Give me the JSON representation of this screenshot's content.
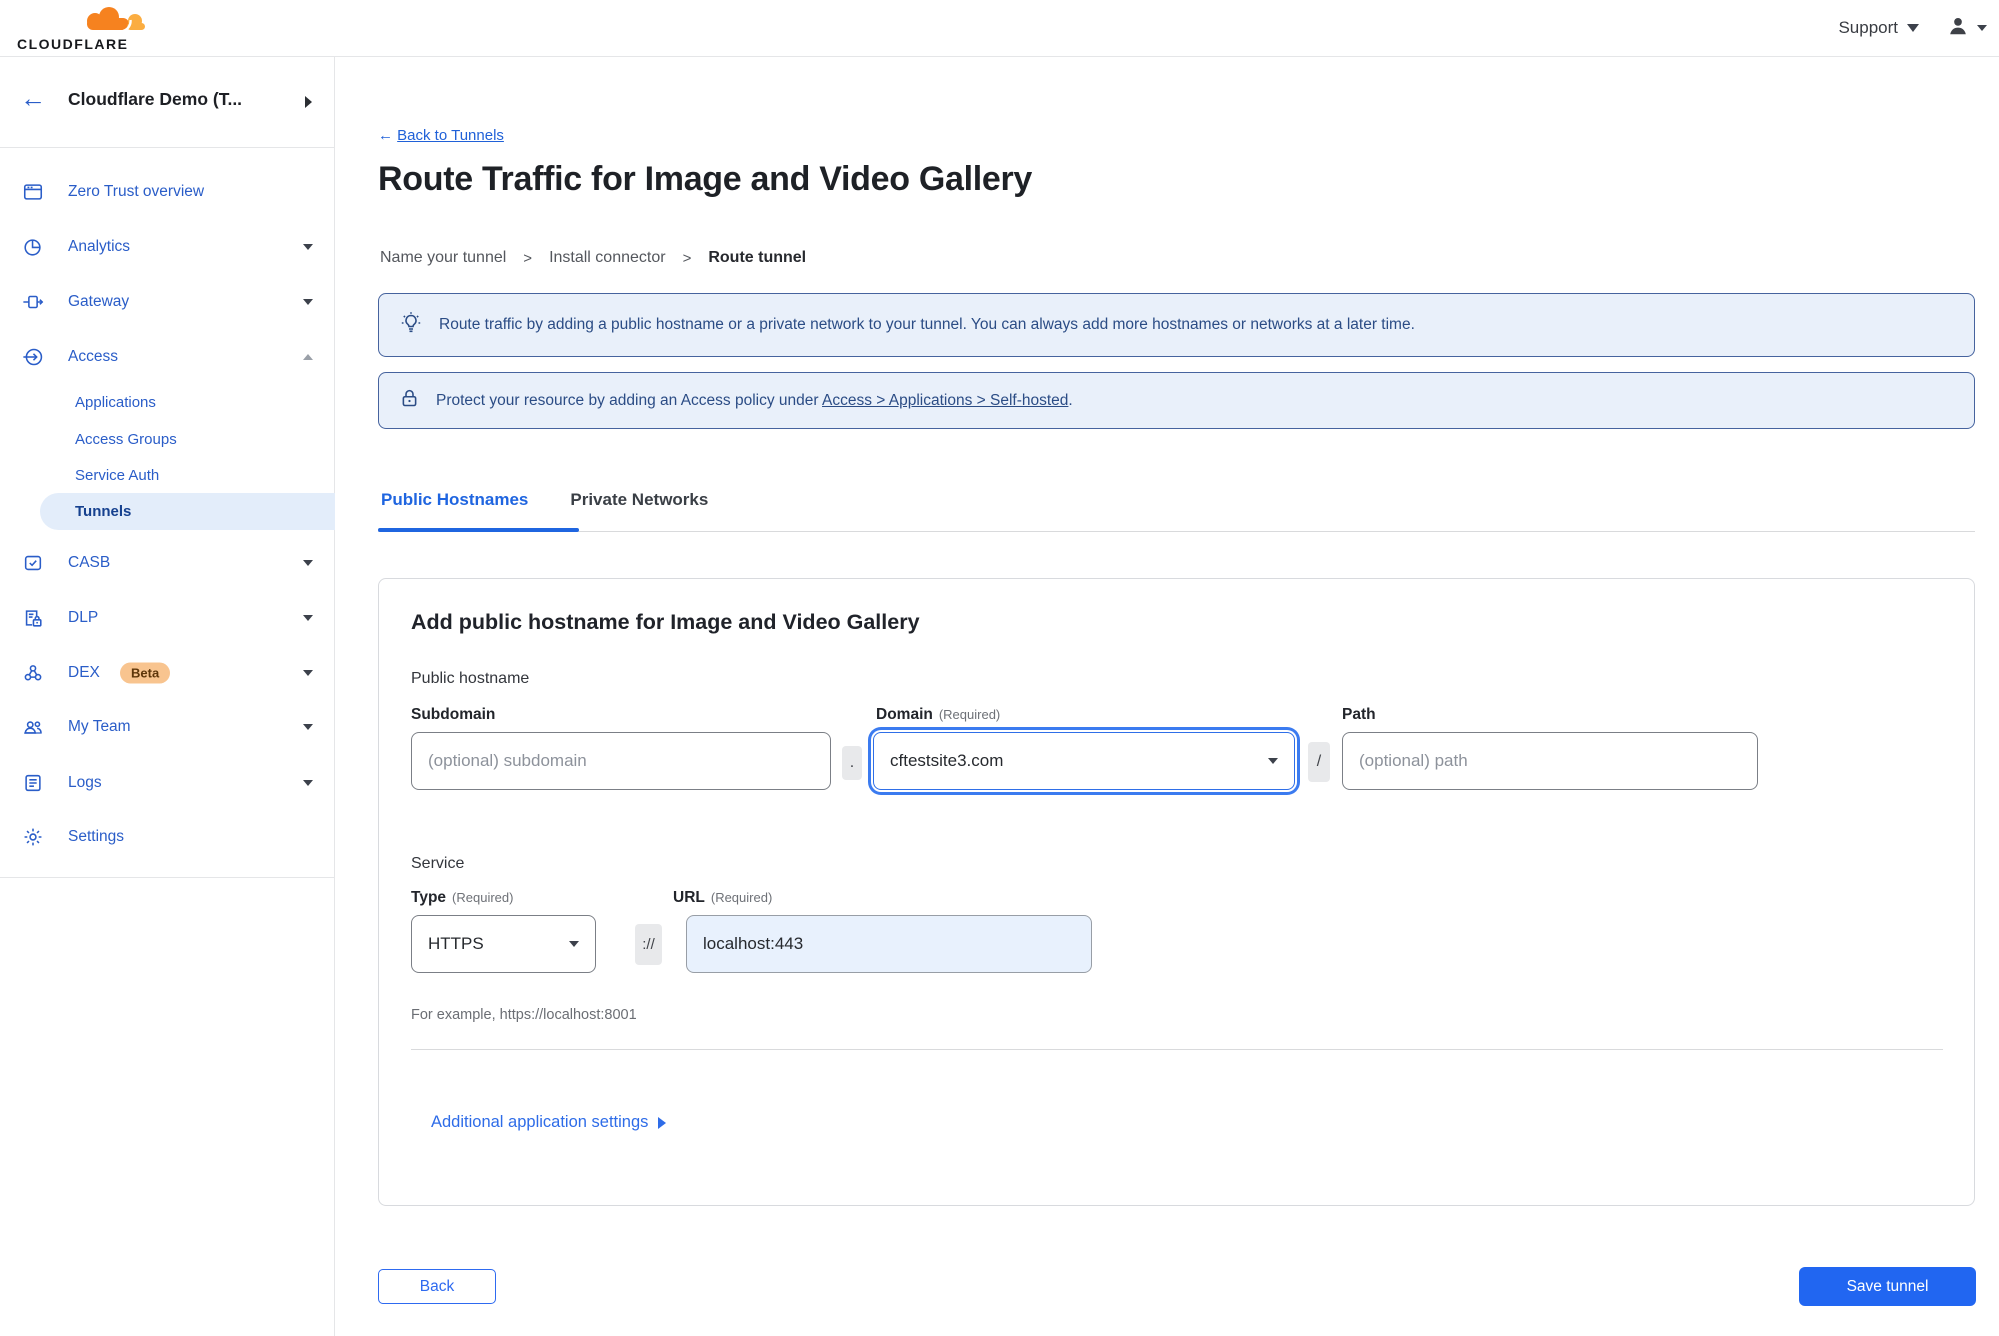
{
  "colors": {
    "brand_orange": "#F6821F",
    "brand_orange_light": "#FBAD41",
    "nav_blue": "#2A5DC8",
    "active_tab_blue": "#1F65E0",
    "save_button_blue": "#2166F1",
    "banner_bg": "#E9F0FA",
    "banner_border": "#46639E",
    "banner_text": "#2B4C85",
    "active_pill_bg": "#E3EDFA",
    "active_pill_text": "#16418F",
    "beta_badge_bg": "#F8C48F",
    "url_input_bg": "#E8F1FD"
  },
  "topbar": {
    "logo_text": "CLOUDFLARE",
    "support": "Support"
  },
  "sidebar": {
    "team_name": "Cloudflare Demo (T...",
    "items": [
      {
        "label": "Zero Trust overview"
      },
      {
        "label": "Analytics"
      },
      {
        "label": "Gateway"
      },
      {
        "label": "Access"
      },
      {
        "label": "CASB"
      },
      {
        "label": "DLP"
      },
      {
        "label": "DEX",
        "badge": "Beta"
      },
      {
        "label": "My Team"
      },
      {
        "label": "Logs"
      },
      {
        "label": "Settings"
      }
    ],
    "access_children": [
      {
        "label": "Applications"
      },
      {
        "label": "Access Groups"
      },
      {
        "label": "Service Auth"
      },
      {
        "label": "Tunnels"
      }
    ],
    "active_child": "Tunnels"
  },
  "page": {
    "back_arrow": "←",
    "back_link": "Back to Tunnels",
    "title": "Route Traffic for Image and Video Gallery",
    "steps": {
      "s1": "Name your tunnel",
      "s2": "Install connector",
      "s3": "Route tunnel",
      "sep": ">"
    },
    "banner_info": "Route traffic by adding a public hostname or a private network to your tunnel. You can always add more hostnames or networks at a later time.",
    "banner_access_prefix": "Protect your resource by adding an Access policy under",
    "banner_access_link": "Access > Applications > Self-hosted",
    "banner_access_suffix": ".",
    "tabs": {
      "public": "Public Hostnames",
      "private": "Private Networks"
    }
  },
  "form": {
    "card_title": "Add public hostname for Image and Video Gallery",
    "section_hostname": "Public hostname",
    "subdomain_label": "Subdomain",
    "subdomain_placeholder": "(optional) subdomain",
    "dot_separator": ".",
    "domain_label": "Domain",
    "required_hint": "(Required)",
    "domain_value": "cftestsite3.com",
    "slash_separator": "/",
    "path_label": "Path",
    "path_placeholder": "(optional) path",
    "section_service": "Service",
    "type_label": "Type",
    "type_value": "HTTPS",
    "scheme_separator": "://",
    "url_label": "URL",
    "url_value": "localhost:443",
    "url_example": "For example, https://localhost:8001",
    "additional_settings": "Additional application settings"
  },
  "footer": {
    "back": "Back",
    "save": "Save tunnel"
  }
}
